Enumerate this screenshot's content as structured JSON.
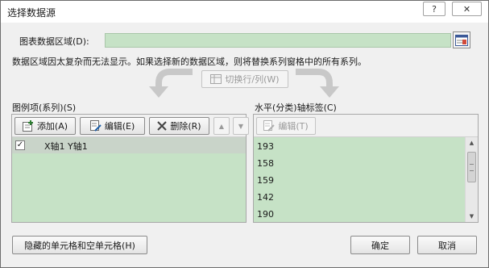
{
  "window": {
    "title": "选择数据源",
    "help_label": "?",
    "close_label": "✕"
  },
  "chart_range": {
    "label": "图表数据区域(D):",
    "value": ""
  },
  "warning_text": "数据区域因太复杂而无法显示。如果选择新的数据区域，则将替换系列窗格中的所有系列。",
  "switch_button": {
    "label": "切换行/列(W)"
  },
  "legend_panel": {
    "title": "图例项(系列)(S)",
    "add_label": "添加(A)",
    "edit_label": "编辑(E)",
    "delete_label": "删除(R)",
    "up_label": "▲",
    "down_label": "▼",
    "series": [
      {
        "checked": true,
        "name": "X轴1  Y轴1"
      }
    ]
  },
  "axis_panel": {
    "title": "水平(分类)轴标签(C)",
    "edit_label": "编辑(T)",
    "items": [
      "193",
      "158",
      "159",
      "142",
      "190"
    ]
  },
  "footer": {
    "hidden_cells_label": "隐藏的单元格和空单元格(H)",
    "ok_label": "确定",
    "cancel_label": "取消"
  },
  "colors": {
    "list_background": "#c6e2c6",
    "selected_row": "#c9d4c9",
    "dialog_background": "#f0f0f0"
  }
}
